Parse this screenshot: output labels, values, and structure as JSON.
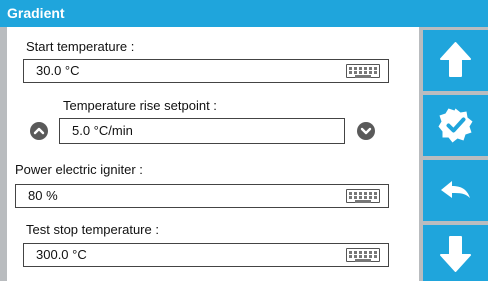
{
  "window": {
    "title": "Gradient"
  },
  "fields": {
    "start_temperature": {
      "label": "Start temperature :",
      "value": "30.0 °C"
    },
    "temperature_rise": {
      "label": "Temperature rise setpoint :",
      "value": "5.0 °C/min"
    },
    "power_igniter": {
      "label": "Power electric igniter :",
      "value": "80 %"
    },
    "stop_temperature": {
      "label": "Test stop temperature :",
      "value": "300.0 °C"
    }
  },
  "icons": {
    "keyboard": "keyboard-icon",
    "increase": "chevron-up-icon",
    "decrease": "chevron-down-icon",
    "up": "arrow-up-icon",
    "validate": "check-badge-icon",
    "back": "back-arrow-icon",
    "down": "arrow-down-icon"
  },
  "colors": {
    "accent": "#1fa5dc",
    "frame": "#b9bcbf",
    "round_button": "#5a5a5a"
  }
}
